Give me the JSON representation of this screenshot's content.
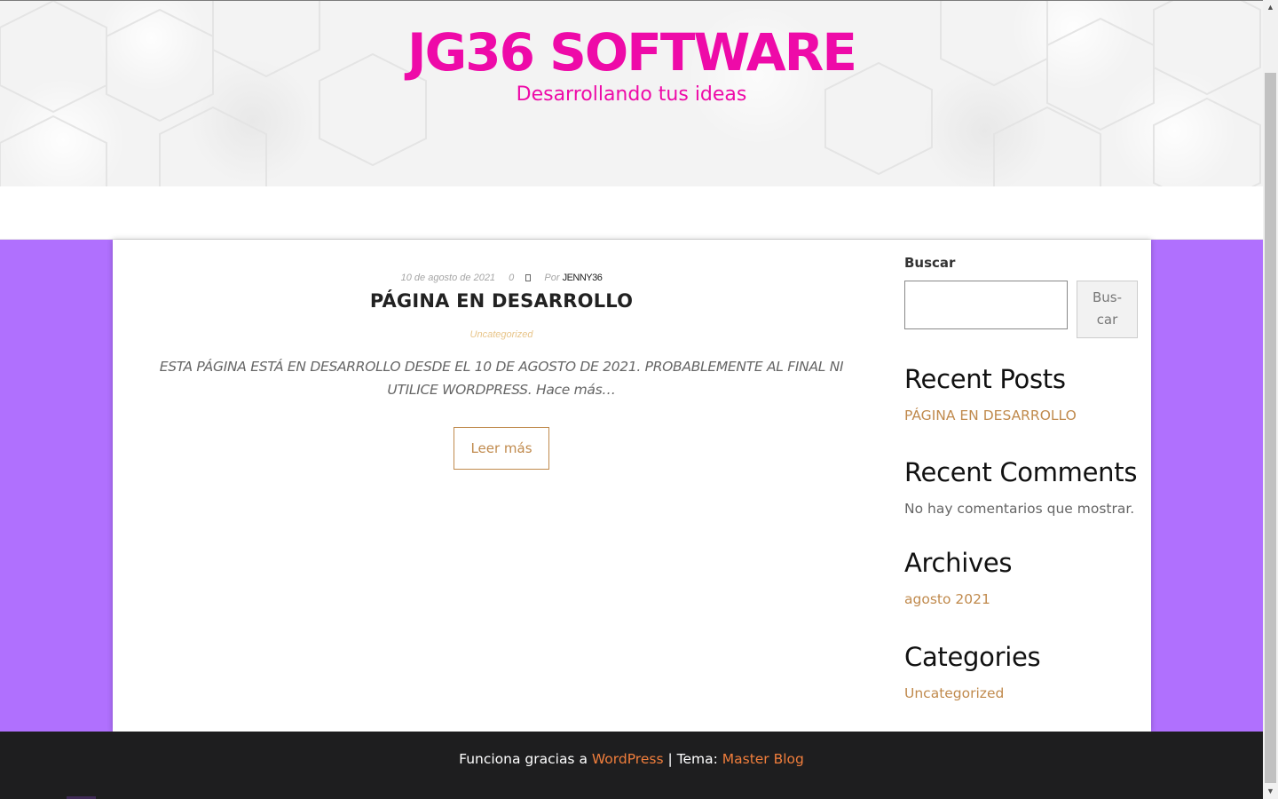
{
  "header": {
    "site_title": "JG36 SOFTWARE",
    "tagline": "Desarrollando tus ideas",
    "title_color": "#ee0aa8"
  },
  "post": {
    "date": "10 de agosto de 2021",
    "comment_count": "0",
    "comment_icon": "comment-icon",
    "by_label": "Por",
    "author": "JENNY36",
    "title": "PÁGINA EN DESARROLLO",
    "category": "Uncategorized",
    "excerpt": "ESTA PÁGINA ESTÁ EN DESARROLLO DESDE EL 10 DE AGOSTO DE 2021. PROBABLEMENTE AL FINAL NI UTILICE WORDPRESS. Hace más…",
    "read_more": "Leer más"
  },
  "sidebar": {
    "search_label": "Buscar",
    "search_value": "",
    "search_button": "Bus-car",
    "recent_posts_title": "Recent Posts",
    "recent_posts": [
      "PÁGINA EN DESARROLLO"
    ],
    "recent_comments_title": "Recent Comments",
    "recent_comments_empty": "No hay comentarios que mostrar.",
    "archives_title": "Archives",
    "archives": [
      "agosto 2021"
    ],
    "categories_title": "Categories",
    "categories": [
      "Uncategorized"
    ]
  },
  "footer": {
    "powered_prefix": "Funciona gracias a",
    "powered_link": "WordPress",
    "separator": "| Tema:",
    "theme_link": "Master Blog"
  },
  "colors": {
    "accent_purple": "#b070fe",
    "link_gold": "#c08a4d",
    "footer_link": "#f07e3c",
    "footer_bg": "#1e1e1f"
  }
}
